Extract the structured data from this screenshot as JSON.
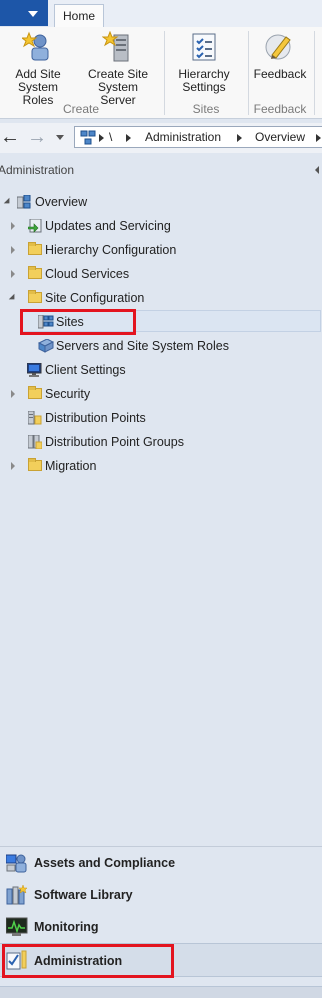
{
  "ribbon": {
    "tab_home": "Home",
    "buttons": {
      "add_site_roles": [
        "Add Site",
        "System Roles"
      ],
      "create_site_server": [
        "Create Site",
        "System Server"
      ],
      "hierarchy_settings": [
        "Hierarchy",
        "Settings"
      ],
      "feedback": [
        "Feedback"
      ]
    },
    "groups": {
      "create": "Create",
      "sites": "Sites",
      "feedback": "Feedback"
    }
  },
  "address_bar": {
    "root": "\\",
    "crumbs": [
      "Administration",
      "Overview"
    ]
  },
  "nav_pane": {
    "title": "Administration",
    "tree": {
      "overview": "Overview",
      "updates": "Updates and Servicing",
      "hierarchy": "Hierarchy Configuration",
      "cloud": "Cloud Services",
      "site_config": "Site Configuration",
      "sites": "Sites",
      "servers_roles": "Servers and Site System Roles",
      "client_settings": "Client Settings",
      "security": "Security",
      "distribution_points": "Distribution Points",
      "dp_groups": "Distribution Point Groups",
      "migration": "Migration"
    }
  },
  "workspaces": {
    "assets": "Assets and Compliance",
    "software": "Software Library",
    "monitoring": "Monitoring",
    "administration": "Administration"
  },
  "colors": {
    "accent": "#1d56a8",
    "highlight": "#e3141f",
    "selection": "#dbe5f2"
  }
}
